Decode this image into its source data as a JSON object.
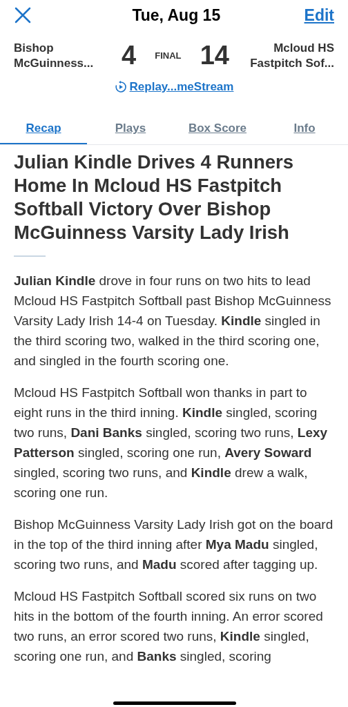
{
  "header": {
    "title": "Tue, Aug 15",
    "edit": "Edit"
  },
  "score": {
    "away_team": "Bishop McGuinness...",
    "away_score": "4",
    "status": "FINAL",
    "home_score": "14",
    "home_team": "Mcloud HS Fastpitch Sof...",
    "replay_link": "Replay...meStream"
  },
  "tabs": [
    {
      "label": "Recap",
      "selected": true
    },
    {
      "label": "Plays",
      "selected": false
    },
    {
      "label": "Box Score",
      "selected": false
    },
    {
      "label": "Info",
      "selected": false
    }
  ],
  "article": {
    "headline": "Julian Kindle Drives 4 Runners Home In Mcloud HS Fastpitch Softball Victory Over Bishop McGuinness Varsity Lady Irish",
    "paragraphs": [
      "**Julian Kindle** drove in four runs on two hits to lead Mcloud HS Fastpitch Softball past Bishop McGuinness Varsity Lady Irish 14-4 on Tuesday. **Kindle** singled in the third scoring two, walked in the third scoring one, and singled in the fourth scoring one.",
      "Mcloud HS Fastpitch Softball won thanks in part to eight runs in the third inning.  **Kindle** singled, scoring two runs, **Dani Banks** singled, scoring two runs, **Lexy Patterson** singled, scoring one run, **Avery Soward** singled, scoring two runs, and **Kindle** drew a walk, scoring one run.",
      "Bishop McGuinness Varsity Lady Irish got on the board in the top of the third inning after **Mya Madu** singled, scoring two runs, and **Madu** scored after tagging up.",
      "Mcloud HS Fastpitch Softball scored six runs on two hits in the bottom of the fourth inning. An error scored two runs, an error scored two runs, **Kindle** singled, scoring one run, and **Banks** singled, scoring"
    ]
  }
}
